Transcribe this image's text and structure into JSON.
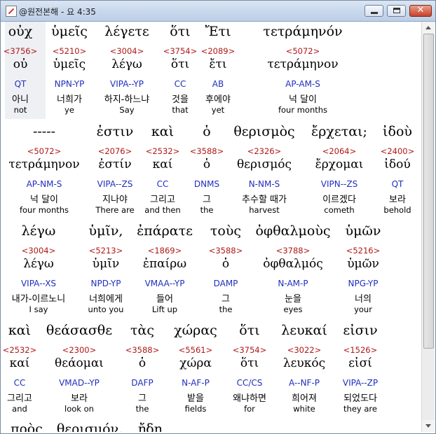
{
  "window": {
    "title": "@원전본해 - 요 4:35",
    "minimize_icon": "minimize-icon",
    "maximize_icon": "maximize-icon",
    "close_icon": "close-icon",
    "close_glyph": "✕"
  },
  "interlinear": {
    "rows": [
      {
        "words": [
          {
            "greek": "οὐχ",
            "strong": "<3756>",
            "lemma": "οὐ",
            "parse": "QT",
            "korean": "아니",
            "english": "not"
          },
          {
            "greek": "ὑμεῖς",
            "strong": "<5210>",
            "lemma": "ὑμεῖς",
            "parse": "NPN-YP",
            "korean": "너희가",
            "english": "ye"
          },
          {
            "greek": "λέγετε",
            "strong": "<3004>",
            "lemma": "λέγω",
            "parse": "VIPA--YP",
            "korean": "하지-하느냐",
            "english": "Say"
          },
          {
            "greek": "ὅτι",
            "strong": "<3754>",
            "lemma": "ὅτι",
            "parse": "CC",
            "korean": "것을",
            "english": "that"
          },
          {
            "greek": "Ἔτι",
            "strong": "<2089>",
            "lemma": "ἔτι",
            "parse": "AB",
            "korean": "후에야",
            "english": "yet"
          },
          {
            "greek": "τετράμηνόν",
            "strong": "<5072>",
            "lemma": "τετράμηνον",
            "parse": "AP-AM-S",
            "korean": "넉 달이",
            "english": "four months"
          }
        ]
      },
      {
        "words": [
          {
            "greek": "-----",
            "strong": "<5072>",
            "lemma": "τετράμηνον",
            "parse": "AP-NM-S",
            "korean": "넉 달이",
            "english": "four months"
          },
          {
            "greek": "ἐστιν",
            "strong": "<2076>",
            "lemma": "ἐστίν",
            "parse": "VIPA--ZS",
            "korean": "지나야",
            "english": "There are"
          },
          {
            "greek": "καὶ",
            "strong": "<2532>",
            "lemma": "καί",
            "parse": "CC",
            "korean": "그리고",
            "english": "and then"
          },
          {
            "greek": "ὁ",
            "strong": "<3588>",
            "lemma": "ὁ",
            "parse": "DNMS",
            "korean": "그",
            "english": "the"
          },
          {
            "greek": "θερισμὸς",
            "strong": "<2326>",
            "lemma": "θερισμός",
            "parse": "N-NM-S",
            "korean": "추수할 때가",
            "english": "harvest"
          },
          {
            "greek": "ἔρχεται;",
            "strong": "<2064>",
            "lemma": "ἔρχομαι",
            "parse": "VIPN--ZS",
            "korean": "이르겠다",
            "english": "cometh"
          },
          {
            "greek": "ἰδοὺ",
            "strong": "<2400>",
            "lemma": "ἰδού",
            "parse": "QT",
            "korean": "보라",
            "english": "behold"
          }
        ]
      },
      {
        "words": [
          {
            "greek": "λέγω",
            "strong": "<3004>",
            "lemma": "λέγω",
            "parse": "VIPA--XS",
            "korean": "내가-이르노니",
            "english": "I say"
          },
          {
            "greek": "ὑμῖν,",
            "strong": "<5213>",
            "lemma": "ὑμῖν",
            "parse": "NPD-YP",
            "korean": "너희에게",
            "english": "unto you"
          },
          {
            "greek": "ἐπάρατε",
            "strong": "<1869>",
            "lemma": "ἐπαίρω",
            "parse": "VMAA--YP",
            "korean": "들어",
            "english": "Lift up"
          },
          {
            "greek": "τοὺς",
            "strong": "<3588>",
            "lemma": "ὁ",
            "parse": "DAMP",
            "korean": "그",
            "english": "the"
          },
          {
            "greek": "ὀφθαλμοὺς",
            "strong": "<3788>",
            "lemma": "ὀφθαλμός",
            "parse": "N-AM-P",
            "korean": "눈을",
            "english": "eyes"
          },
          {
            "greek": "ὑμῶν",
            "strong": "<5216>",
            "lemma": "ὑμῶν",
            "parse": "NPG-YP",
            "korean": "너의",
            "english": "your"
          }
        ]
      },
      {
        "words": [
          {
            "greek": "καὶ",
            "strong": "<2532>",
            "lemma": "καί",
            "parse": "CC",
            "korean": "그리고",
            "english": "and"
          },
          {
            "greek": "θεάσασθε",
            "strong": "<2300>",
            "lemma": "θεάομαι",
            "parse": "VMAD--YP",
            "korean": "보라",
            "english": "look on"
          },
          {
            "greek": "τὰς",
            "strong": "<3588>",
            "lemma": "ὁ",
            "parse": "DAFP",
            "korean": "그",
            "english": "the"
          },
          {
            "greek": "χώρας",
            "strong": "<5561>",
            "lemma": "χώρα",
            "parse": "N-AF-P",
            "korean": "밭을",
            "english": "fields"
          },
          {
            "greek": "ὅτι",
            "strong": "<3754>",
            "lemma": "ὅτι",
            "parse": "CC/CS",
            "korean": "왜냐하면",
            "english": "for"
          },
          {
            "greek": "λευκαί",
            "strong": "<3022>",
            "lemma": "λευκός",
            "parse": "A--NF-P",
            "korean": "희어져",
            "english": "white"
          },
          {
            "greek": "εἰσιν",
            "strong": "<1526>",
            "lemma": "εἰσί",
            "parse": "VIPA--ZP",
            "korean": "되었도다",
            "english": "they are"
          }
        ]
      },
      {
        "words": [
          {
            "greek": "πρὸς",
            "strong": "",
            "lemma": "",
            "parse": "",
            "korean": "",
            "english": ""
          },
          {
            "greek": "θερισμόν.",
            "strong": "",
            "lemma": "",
            "parse": "",
            "korean": "",
            "english": ""
          },
          {
            "greek": "ἤδη",
            "strong": "",
            "lemma": "",
            "parse": "",
            "korean": "",
            "english": ""
          }
        ]
      }
    ]
  },
  "scrollbar": {
    "up_icon": "scroll-up-arrow-icon",
    "down_icon": "scroll-down-arrow-icon"
  },
  "colors": {
    "strong_number": "#b01818",
    "parsing_code": "#1f2fbf",
    "text": "#000000"
  }
}
